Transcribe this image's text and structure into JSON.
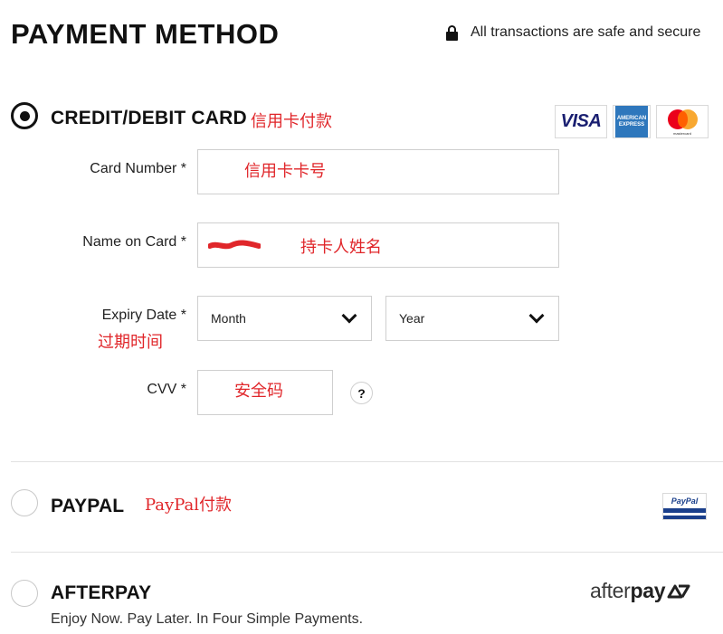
{
  "header": {
    "title": "PAYMENT METHOD",
    "secure_text": "All transactions are safe and secure",
    "secure_icon": "lock-icon"
  },
  "credit_card": {
    "label": "CREDIT/DEBIT CARD",
    "annotation": "信用卡付款",
    "selected": true,
    "logos": {
      "visa": "VISA",
      "amex_line1": "AMERICAN",
      "amex_line2": "EXPRESS",
      "mastercard": "mastercard"
    },
    "fields": {
      "card_number": {
        "label": "Card Number *",
        "value": "",
        "annotation": "信用卡卡号"
      },
      "name_on_card": {
        "label": "Name on Card *",
        "value": "",
        "annotation": "持卡人姓名"
      },
      "expiry": {
        "label": "Expiry Date *",
        "annotation": "过期时间",
        "month": "Month",
        "year": "Year"
      },
      "cvv": {
        "label": "CVV *",
        "annotation": "安全码",
        "help": "?"
      }
    }
  },
  "paypal": {
    "label": "PAYPAL",
    "annotation": "PayPal付款",
    "selected": false,
    "logo_text": "PayPal"
  },
  "afterpay": {
    "label": "AFTERPAY",
    "selected": false,
    "logo_text_light": "after",
    "logo_text_bold": "pay",
    "description": "Enjoy Now. Pay Later. In Four Simple Payments."
  },
  "colors": {
    "annotation_red": "#e0262a",
    "visa_blue": "#1a1f71",
    "amex_blue": "#2e77bc",
    "paypal_blue": "#1a3f8b"
  }
}
